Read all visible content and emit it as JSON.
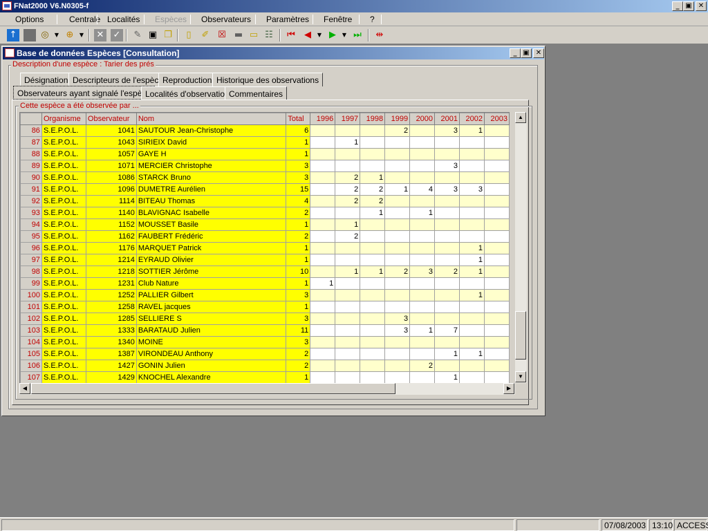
{
  "app": {
    "title": "FNat2000 V6.N0305-f",
    "minimize": "_",
    "maximize": "▣",
    "close": "✕"
  },
  "menu": [
    "Options",
    "Centrale",
    "Localités",
    "Espèces",
    "Observateurs",
    "Paramètres",
    "Fenêtre",
    "?"
  ],
  "menu_disabled": "Espèces",
  "toolbar": [
    "back-icon",
    "stop-icon",
    "refresh-icon",
    "target-icon",
    "delete-icon",
    "check-icon",
    "pin-icon",
    "save-icon",
    "copy-icon",
    "new-doc-icon",
    "edit-icon",
    "cancel-icon",
    "print-icon",
    "open-folder-icon",
    "tree-icon",
    "first-record-icon",
    "prev-record-icon",
    "next-record-icon",
    "last-record-icon",
    "close-record-icon"
  ],
  "window": {
    "title": "Base de données Espèces [Consultation]"
  },
  "description_label": "Description d'une espèce : Tarier des prés",
  "tabs_row1": [
    "Désignation",
    "Descripteurs de l'espèce",
    "Reproduction",
    "Historique des observations"
  ],
  "tabs_row2": [
    "Observateurs ayant signalé l'espèce",
    "Localités d'observation",
    "Commentaires"
  ],
  "group_label": "Cette espèce a été observée par ...",
  "columns": [
    "Organisme",
    "Observateur",
    "Nom",
    "Total",
    "1996",
    "1997",
    "1998",
    "1999",
    "2000",
    "2001",
    "2002",
    "2003"
  ],
  "rows": [
    {
      "n": "86",
      "org": "S.E.P.O.L.",
      "obs": "1041",
      "nom": "SAUTOUR Jean-Christophe",
      "total": "6",
      "y": [
        "",
        "",
        "",
        "2",
        "",
        "3",
        "1",
        ""
      ]
    },
    {
      "n": "87",
      "org": "S.E.P.O.L.",
      "obs": "1043",
      "nom": "SIRIEIX David",
      "total": "1",
      "y": [
        "",
        "1",
        "",
        "",
        "",
        "",
        "",
        ""
      ]
    },
    {
      "n": "88",
      "org": "S.E.P.O.L.",
      "obs": "1057",
      "nom": "GAYE H",
      "total": "1",
      "y": [
        "",
        "",
        "",
        "",
        "",
        "",
        "",
        ""
      ]
    },
    {
      "n": "89",
      "org": "S.E.P.O.L.",
      "obs": "1071",
      "nom": "MERCIER Christophe",
      "total": "3",
      "y": [
        "",
        "",
        "",
        "",
        "",
        "3",
        "",
        ""
      ]
    },
    {
      "n": "90",
      "org": "S.E.P.O.L.",
      "obs": "1086",
      "nom": "STARCK Bruno",
      "total": "3",
      "y": [
        "",
        "2",
        "1",
        "",
        "",
        "",
        "",
        ""
      ]
    },
    {
      "n": "91",
      "org": "S.E.P.O.L.",
      "obs": "1096",
      "nom": "DUMETRE Aurélien",
      "total": "15",
      "y": [
        "",
        "2",
        "2",
        "1",
        "4",
        "3",
        "3",
        ""
      ]
    },
    {
      "n": "92",
      "org": "S.E.P.O.L.",
      "obs": "1114",
      "nom": "BITEAU Thomas",
      "total": "4",
      "y": [
        "",
        "2",
        "2",
        "",
        "",
        "",
        "",
        ""
      ]
    },
    {
      "n": "93",
      "org": "S.E.P.O.L.",
      "obs": "1140",
      "nom": "BLAVIGNAC Isabelle",
      "total": "2",
      "y": [
        "",
        "",
        "1",
        "",
        "1",
        "",
        "",
        ""
      ]
    },
    {
      "n": "94",
      "org": "S.E.P.O.L.",
      "obs": "1152",
      "nom": "MOUSSET Basile",
      "total": "1",
      "y": [
        "",
        "1",
        "",
        "",
        "",
        "",
        "",
        ""
      ]
    },
    {
      "n": "95",
      "org": "S.E.P.O.L.",
      "obs": "1162",
      "nom": "FAUBERT Frédéric",
      "total": "2",
      "y": [
        "",
        "2",
        "",
        "",
        "",
        "",
        "",
        ""
      ]
    },
    {
      "n": "96",
      "org": "S.E.P.O.L.",
      "obs": "1176",
      "nom": "MARQUET Patrick",
      "total": "1",
      "y": [
        "",
        "",
        "",
        "",
        "",
        "",
        "1",
        ""
      ]
    },
    {
      "n": "97",
      "org": "S.E.P.O.L.",
      "obs": "1214",
      "nom": "EYRAUD Olivier",
      "total": "1",
      "y": [
        "",
        "",
        "",
        "",
        "",
        "",
        "1",
        ""
      ]
    },
    {
      "n": "98",
      "org": "S.E.P.O.L.",
      "obs": "1218",
      "nom": "SOTTIER Jérôme",
      "total": "10",
      "y": [
        "",
        "1",
        "1",
        "2",
        "3",
        "2",
        "1",
        ""
      ]
    },
    {
      "n": "99",
      "org": "S.E.P.O.L.",
      "obs": "1231",
      "nom": "Club Nature",
      "total": "1",
      "y": [
        "1",
        "",
        "",
        "",
        "",
        "",
        "",
        ""
      ]
    },
    {
      "n": "100",
      "org": "S.E.P.O.L.",
      "obs": "1252",
      "nom": "PALLIER Gilbert",
      "total": "3",
      "y": [
        "",
        "",
        "",
        "",
        "",
        "",
        "1",
        ""
      ]
    },
    {
      "n": "101",
      "org": "S.E.P.O.L.",
      "obs": "1258",
      "nom": "RAVEL jacques",
      "total": "1",
      "y": [
        "",
        "",
        "",
        "",
        "",
        "",
        "",
        ""
      ]
    },
    {
      "n": "102",
      "org": "S.E.P.O.L.",
      "obs": "1285",
      "nom": "SELLIERE S",
      "total": "3",
      "y": [
        "",
        "",
        "",
        "3",
        "",
        "",
        "",
        ""
      ]
    },
    {
      "n": "103",
      "org": "S.E.P.O.L.",
      "obs": "1333",
      "nom": "BARATAUD Julien",
      "total": "11",
      "y": [
        "",
        "",
        "",
        "3",
        "1",
        "7",
        "",
        ""
      ]
    },
    {
      "n": "104",
      "org": "S.E.P.O.L.",
      "obs": "1340",
      "nom": "MOINE",
      "total": "3",
      "y": [
        "",
        "",
        "",
        "",
        "",
        "",
        "",
        ""
      ]
    },
    {
      "n": "105",
      "org": "S.E.P.O.L.",
      "obs": "1387",
      "nom": "VIRONDEAU Anthony",
      "total": "2",
      "y": [
        "",
        "",
        "",
        "",
        "",
        "1",
        "1",
        ""
      ]
    },
    {
      "n": "106",
      "org": "S.E.P.O.L.",
      "obs": "1427",
      "nom": "GONIN Julien",
      "total": "2",
      "y": [
        "",
        "",
        "",
        "",
        "2",
        "",
        "",
        ""
      ]
    },
    {
      "n": "107",
      "org": "S.E.P.O.L.",
      "obs": "1429",
      "nom": "KNOCHEL Alexandre",
      "total": "1",
      "y": [
        "",
        "",
        "",
        "",
        "",
        "1",
        "",
        ""
      ]
    }
  ],
  "status": {
    "date": "07/08/2003",
    "time": "13:10",
    "mode": "ACCESS"
  },
  "colors": {
    "titlebar": "#0a246a",
    "highlight": "#ffff00",
    "header_text": "#c00000",
    "year_cell": "#ffffcc"
  }
}
